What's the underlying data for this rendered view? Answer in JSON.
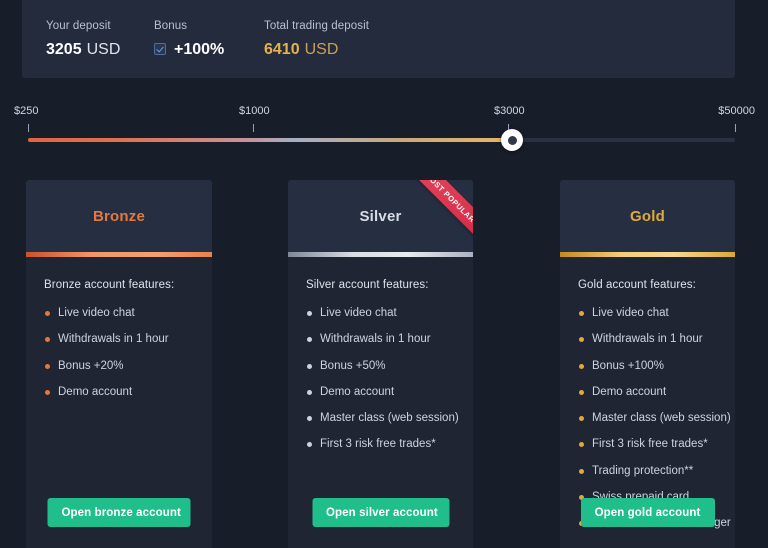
{
  "summary": {
    "deposit_label": "Your deposit",
    "deposit_amount": "3205",
    "deposit_currency": "USD",
    "bonus_label": "Bonus",
    "bonus_value": "+100%",
    "bonus_checked": true,
    "total_label": "Total trading deposit",
    "total_amount": "6410",
    "total_currency": "USD",
    "gold_color": "#e6b24a"
  },
  "slider": {
    "ticks": [
      {
        "label": "$250",
        "pos": 28
      },
      {
        "label": "$1000",
        "pos": 253
      },
      {
        "label": "$3000",
        "pos": 508
      },
      {
        "label": "$50000",
        "pos": 735
      }
    ],
    "value_pos_percent": "68.5",
    "handle_label": "slider-handle",
    "track_color": "#2a3144"
  },
  "cards": [
    {
      "key": "bronze",
      "title": "Bronze",
      "title_color": "#e2793f",
      "badge": null,
      "features_title": "Bronze account features:",
      "features": [
        "Live video chat",
        "Withdrawals in 1 hour",
        "Bonus +20%",
        "Demo account"
      ],
      "cta_label": "Open bronze account"
    },
    {
      "key": "silver",
      "title": "Silver",
      "title_color": "#d7dbe4",
      "badge": "MOST POPULAR",
      "features_title": "Silver account features:",
      "features": [
        "Live video chat",
        "Withdrawals in 1 hour",
        "Bonus +50%",
        "Demo account",
        "Master class (web session)",
        "First 3 risk free trades*"
      ],
      "cta_label": "Open silver account"
    },
    {
      "key": "gold",
      "title": "Gold",
      "title_color": "#e0aa3c",
      "badge": null,
      "features_title": "Gold account features:",
      "features": [
        "Live video chat",
        "Withdrawals in 1 hour",
        "Bonus +100%",
        "Demo account",
        "Master class (web session)",
        "First 3 risk free trades*",
        "Trading protection**",
        "Swiss prepaid card",
        "Personal success manager"
      ],
      "cta_label": "Open gold account"
    }
  ],
  "theme": {
    "page_bg": "#181d2a",
    "panel_bg": "#242b3d",
    "card_bg": "#1f2533",
    "card_head_bg": "#262e41",
    "cta_bg": "#1fbe8a",
    "ribbon_bg": "#d02a45"
  }
}
